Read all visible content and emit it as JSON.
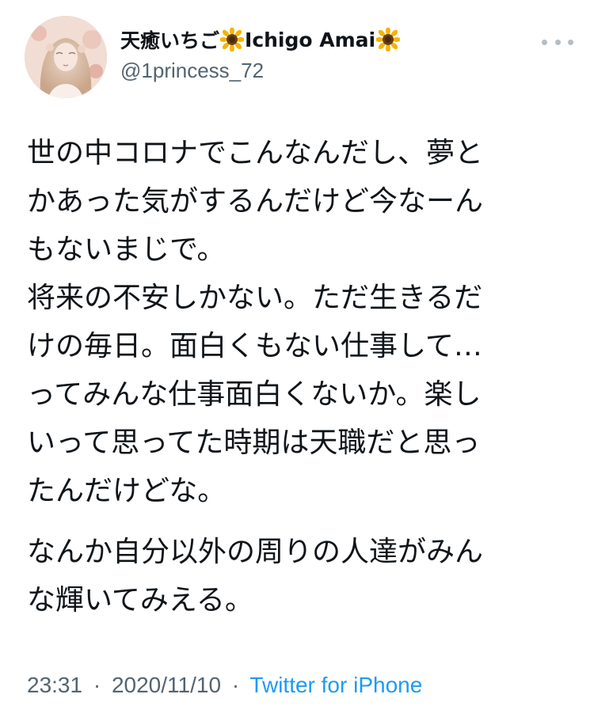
{
  "tweet": {
    "author": {
      "display_name_jp": "天癒いちご",
      "display_name_en": "Ichigo Amai",
      "name_emoji": "sunflower-icon",
      "handle": "@1princess_72"
    },
    "menu_icon": "more-horizontal-icon",
    "body": {
      "paragraph1": "世の中コロナでこんなんだし、夢と\nかあった気がするんだけど今なーん\nもないまじで。\n将来の不安しかない。ただ生きるだ\nけの毎日。面白くもない仕事して…\nってみんな仕事面白くないか。楽し\nいって思ってた時期は天職だと思っ\nたんだけどな。",
      "paragraph2": "なんか自分以外の周りの人達がみん\nな輝いてみえる。"
    },
    "meta": {
      "time": "23:31",
      "separator": "·",
      "date": "2020/11/10",
      "source": "Twitter for iPhone"
    },
    "colors": {
      "text": "#0f1419",
      "secondary": "#536471",
      "link": "#1d9bf0"
    }
  }
}
